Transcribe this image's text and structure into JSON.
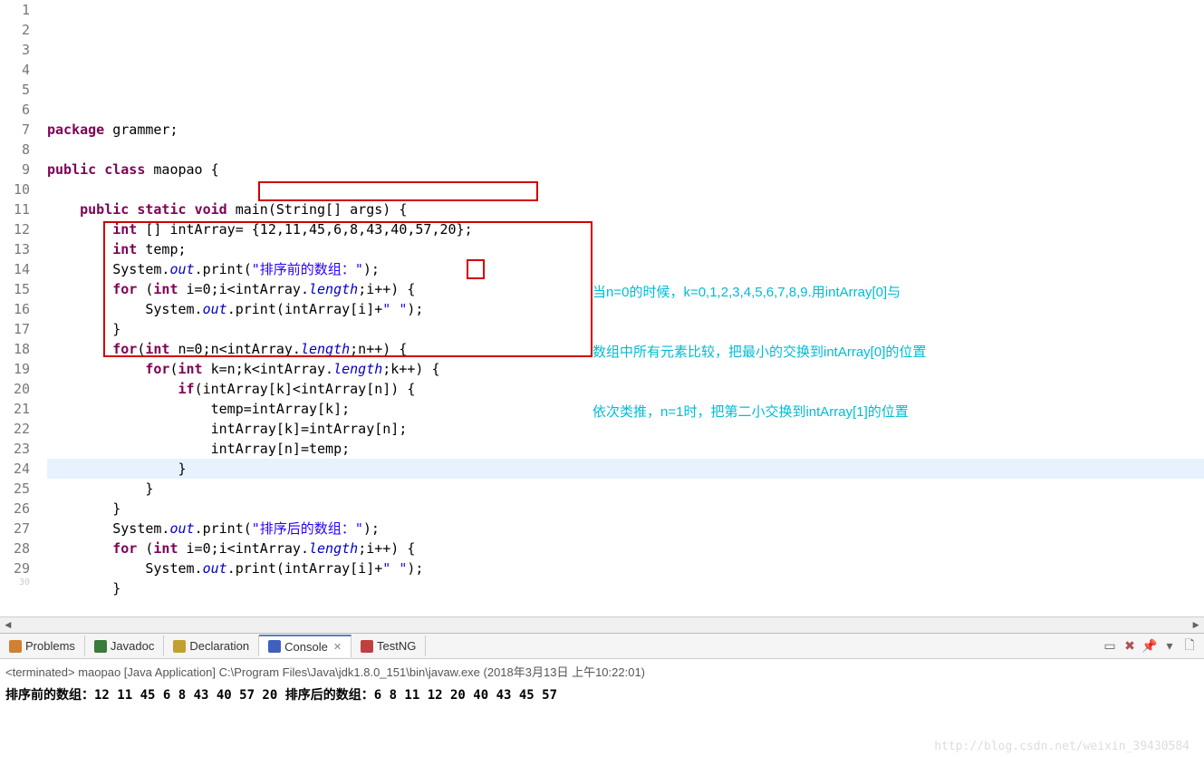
{
  "lines": [
    {
      "n": 1,
      "html": "<span class='kw'>package</span> grammer;"
    },
    {
      "n": 2,
      "html": ""
    },
    {
      "n": 3,
      "html": "<span class='kw'>public</span> <span class='kw'>class</span> maopao {"
    },
    {
      "n": 4,
      "html": ""
    },
    {
      "n": 5,
      "html": "    <span class='kw'>public</span> <span class='kw'>static</span> <span class='kw'>void</span> main(String[] args) {"
    },
    {
      "n": 6,
      "html": "        <span class='kw'>int</span> [] intArray= {12,11,45,6,8,43,40,57,20};"
    },
    {
      "n": 7,
      "html": "        <span class='kw'>int</span> temp;"
    },
    {
      "n": 8,
      "html": "        System.<span class='field'>out</span>.print(<span class='str'>\"排序前的数组：\"</span>);"
    },
    {
      "n": 9,
      "html": "        <span class='kw'>for</span> (<span class='kw'>int</span> i=0;i&lt;intArray.<span class='field'>length</span>;i++) {"
    },
    {
      "n": 10,
      "html": "            System.<span class='field'>out</span>.print(intArray[i]+<span class='str'>\" \"</span>);"
    },
    {
      "n": 11,
      "html": "        }"
    },
    {
      "n": 12,
      "html": "        <span class='kw'>for</span>(<span class='kw'>int</span> n=0;n&lt;intArray.<span class='field'>length</span>;n++) {"
    },
    {
      "n": 13,
      "html": "            <span class='kw'>for</span>(<span class='kw'>int</span> k=n;k&lt;intArray.<span class='field'>length</span>;k++) {"
    },
    {
      "n": 14,
      "html": "                <span class='kw'>if</span>(intArray[k]&lt;intArray[n]) {"
    },
    {
      "n": 15,
      "html": "                    temp=intArray[k];"
    },
    {
      "n": 16,
      "html": "                    intArray[k]=intArray[n];"
    },
    {
      "n": 17,
      "html": "                    intArray[n]=temp;"
    },
    {
      "n": 18,
      "html": "                }",
      "highlight": true
    },
    {
      "n": 19,
      "html": "            }"
    },
    {
      "n": 20,
      "html": "        }"
    },
    {
      "n": 21,
      "html": "        System.<span class='field'>out</span>.print(<span class='str'>\"排序后的数组：\"</span>);"
    },
    {
      "n": 22,
      "html": "        <span class='kw'>for</span> (<span class='kw'>int</span> i=0;i&lt;intArray.<span class='field'>length</span>;i++) {"
    },
    {
      "n": 23,
      "html": "            System.<span class='field'>out</span>.print(intArray[i]+<span class='str'>\" \"</span>);"
    },
    {
      "n": 24,
      "html": "        }"
    },
    {
      "n": 25,
      "html": ""
    },
    {
      "n": 26,
      "html": ""
    },
    {
      "n": 27,
      "html": "    }"
    },
    {
      "n": 28,
      "html": ""
    },
    {
      "n": 29,
      "html": "}"
    },
    {
      "n": 30,
      "html": "",
      "partial": true
    }
  ],
  "annotation": {
    "line1": "当n=0的时候，k=0,1,2,3,4,5,6,7,8,9.用intArray[0]与",
    "line2": "数组中所有元素比较，把最小的交换到intArray[0]的位置",
    "line3": "依次类推，n=1时，把第二小交换到intArray[1]的位置"
  },
  "tabs": [
    {
      "icon": "problems",
      "label": "Problems",
      "color": "#d08030"
    },
    {
      "icon": "javadoc",
      "label": "Javadoc",
      "color": "#3a7a3a"
    },
    {
      "icon": "declaration",
      "label": "Declaration",
      "color": "#c0a030"
    },
    {
      "icon": "console",
      "label": "Console",
      "color": "#4060c0",
      "active": true,
      "closable": true
    },
    {
      "icon": "testng",
      "label": "TestNG",
      "color": "#c04040"
    }
  ],
  "console": {
    "header": "<terminated> maopao [Java Application] C:\\Program Files\\Java\\jdk1.8.0_151\\bin\\javaw.exe (2018年3月13日 上午10:22:01)",
    "output_prefix1": "排序前的数组：",
    "output_values1": "12 11 45 6 8 43 40 57 20 ",
    "output_prefix2": "排序后的数组：",
    "output_values2": "6 8 11 12 20 40 43 45 57 "
  },
  "watermark": "http://blog.csdn.net/weixin_39430584",
  "actions": [
    "monitor",
    "remove-all",
    "pin",
    "dropdown",
    "page"
  ]
}
